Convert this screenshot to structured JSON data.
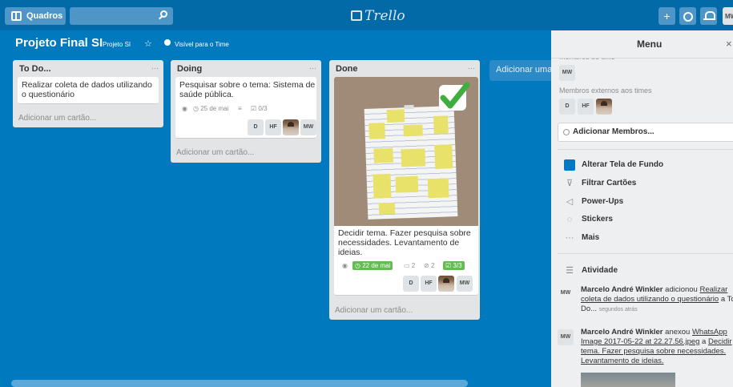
{
  "topbar": {
    "boards_label": "Quadros",
    "logo_text": "Trello",
    "add_label": "+",
    "user_initials": "MW"
  },
  "board": {
    "title": "Projeto Final SI",
    "team": "Projeto SI",
    "visibility": "Visível para o Time"
  },
  "lists": [
    {
      "title": "To Do...",
      "menu": "...",
      "cards": [
        {
          "text": "Realizar coleta de dados utilizando o questionário"
        }
      ],
      "add_card": "Adicionar um cartão..."
    },
    {
      "title": "Doing",
      "menu": "...",
      "cards": [
        {
          "text": "Pesquisar sobre o tema: Sistema de saúde pública.",
          "due": "25 de mai",
          "checklist": "0/3",
          "members": [
            "D",
            "HF",
            "MW"
          ]
        }
      ],
      "add_card": "Adicionar um cartão..."
    },
    {
      "title": "Done",
      "menu": "...",
      "cards": [
        {
          "text": "Decidir tema. Fazer pesquisa sobre necessidades. Levantamento de ideias.",
          "due": "22 de mai",
          "comments": "2",
          "attachments": "2",
          "checklist": "3/3",
          "members": [
            "D",
            "HF",
            "MW"
          ]
        }
      ],
      "add_card": "Adicionar um cartão..."
    }
  ],
  "add_list": "Adicionar uma lista...",
  "menu": {
    "title": "Menu",
    "close": "×",
    "members_label_cut": "Membros do time",
    "member_initials": "MW",
    "external_label": "Membros externos aos times",
    "external_members": [
      "D",
      "HF"
    ],
    "add_members": "Adicionar Membros...",
    "items": [
      {
        "label": "Alterar Tela de Fundo",
        "icon": "color-square-icon"
      },
      {
        "label": "Filtrar Cartões",
        "icon": "filter-icon"
      },
      {
        "label": "Power-Ups",
        "icon": "rocket-icon"
      },
      {
        "label": "Stickers",
        "icon": "sticker-icon"
      },
      {
        "label": "Mais",
        "icon": "more-icon"
      }
    ],
    "activity_title": "Atividade",
    "activities": [
      {
        "initials": "MW",
        "user": "Marcelo André Winkler",
        "action": " adicionou ",
        "link": "Realizar coleta de dados utilizando o questionário",
        "tail": " a To Do...",
        "time": "segundos atrás"
      },
      {
        "initials": "MW",
        "user": "Marcelo André Winkler",
        "action": " anexou ",
        "link": "WhatsApp Image 2017-05-22 at 22.27.56.jpeg",
        "tail": " a ",
        "link2": "Decidir tema. Fazer pesquisa sobre necessidades. Levantamento de ideias."
      }
    ]
  },
  "colors": {
    "board_bg": "#0079bf",
    "topbar_bg": "#026aa7",
    "label_green": "#61bd4f",
    "bg_swatch": "#0079bf"
  }
}
